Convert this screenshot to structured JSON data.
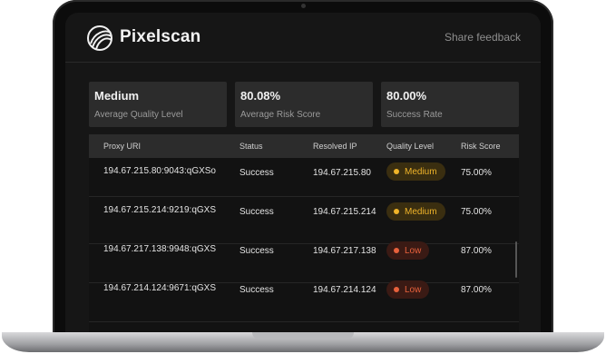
{
  "app": {
    "brand": "Pixelscan",
    "share_feedback": "Share feedback",
    "logo_icon": "pixelscan-logo-icon"
  },
  "stats": [
    {
      "value": "Medium",
      "label": "Average Quality Level"
    },
    {
      "value": "80.08%",
      "label": "Average Risk Score"
    },
    {
      "value": "80.00%",
      "label": "Success Rate"
    }
  ],
  "table": {
    "headers": [
      "Proxy URI",
      "Status",
      "Resolved IP",
      "Quality Level",
      "Risk Score"
    ],
    "rows": [
      {
        "proxy": "194.67.215.80:9043:qGXSo",
        "status": "Success",
        "ip": "194.67.215.80",
        "quality": "Medium",
        "risk": "75.00%"
      },
      {
        "proxy": "194.67.215.214:9219:qGXSc",
        "status": "Success",
        "ip": "194.67.215.214",
        "quality": "Medium",
        "risk": "75.00%"
      },
      {
        "proxy": "194.67.217.138:9948:qGXSo",
        "status": "Success",
        "ip": "194.67.217.138",
        "quality": "Low",
        "risk": "87.00%"
      },
      {
        "proxy": "194.67.214.124:9671:qGXSo",
        "status": "Success",
        "ip": "194.67.214.124",
        "quality": "Low",
        "risk": "87.00%"
      }
    ]
  },
  "colors": {
    "medium": "#f0b429",
    "low": "#e8613c",
    "background": "#161616"
  }
}
